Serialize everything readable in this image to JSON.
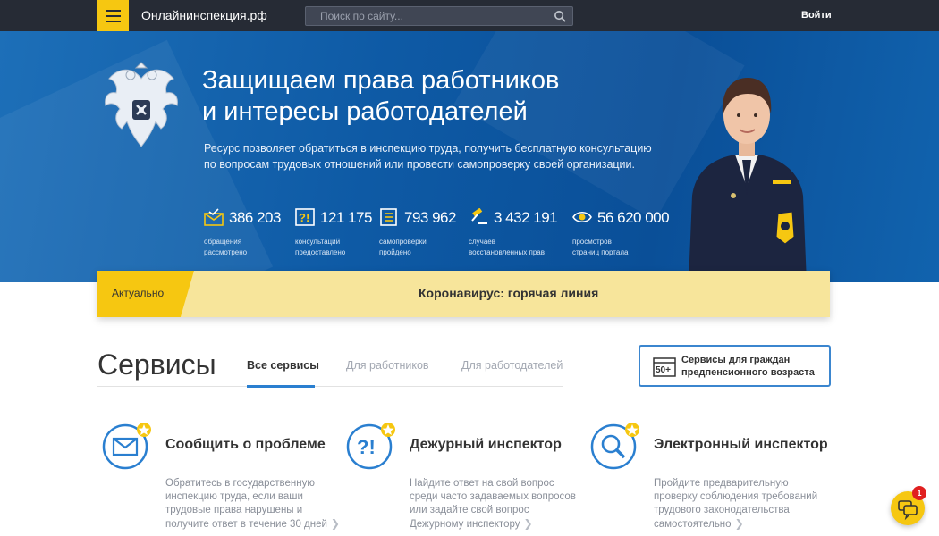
{
  "header": {
    "site_name": "Онлайнинспекция.рф",
    "search_placeholder": "Поиск по сайту...",
    "login_label": "Войти"
  },
  "hero": {
    "title_line1": "Защищаем права работников",
    "title_line2": "и интересы работодателей",
    "desc_line1": "Ресурс позволяет обратиться в инспекцию труда, получить бесплатную консультацию",
    "desc_line2": "по вопросам трудовых отношений или провести самопроверку своей организации.",
    "stats": [
      {
        "icon": "envelope-check-icon",
        "value": "386 203",
        "label1": "обращения",
        "label2": "рассмотрено"
      },
      {
        "icon": "question-icon",
        "value": "121 175",
        "label1": "консультаций",
        "label2": "предоставлено"
      },
      {
        "icon": "checklist-icon",
        "value": "793 962",
        "label1": "самопроверки",
        "label2": "пройдено"
      },
      {
        "icon": "gavel-icon",
        "value": "3 432 191",
        "label1": "случаев",
        "label2": "восстановленных прав"
      },
      {
        "icon": "eye-icon",
        "value": "56 620 000",
        "label1": "просмотров",
        "label2": "страниц портала"
      }
    ]
  },
  "actual": {
    "tag": "Актуально",
    "text": "Коронавирус: горячая линия"
  },
  "services": {
    "title": "Сервисы",
    "tabs": [
      {
        "label": "Все сервисы",
        "active": true
      },
      {
        "label": "Для работников",
        "active": false
      },
      {
        "label": "Для работодателей",
        "active": false
      }
    ],
    "pre_button": {
      "badge": "50+",
      "line1": "Сервисы для граждан",
      "line2": "предпенсионного возраста"
    },
    "cards": [
      {
        "icon": "envelope-icon",
        "title": "Сообщить о проблеме",
        "desc_lines": [
          "Обратитесь в государственную",
          "инспекцию труда, если ваши",
          "трудовые права нарушены и",
          "получите ответ в течение 30 дней"
        ]
      },
      {
        "icon": "question-icon",
        "title": "Дежурный инспектор",
        "desc_lines": [
          "Найдите ответ на свой вопрос",
          "среди часто задаваемых вопросов",
          "или задайте свой вопрос",
          "Дежурному инспектору"
        ]
      },
      {
        "icon": "magnifier-icon",
        "title": "Электронный инспектор",
        "desc_lines": [
          "Пройдите предварительную",
          "проверку соблюдения требований",
          "трудового законодательства",
          "самостоятельно"
        ]
      }
    ]
  },
  "chat": {
    "badge_count": "1"
  },
  "colors": {
    "accent_yellow": "#f6c711",
    "hero_blue": "#0e5aa5",
    "link_blue": "#2a7fd0",
    "topbar": "#262b35"
  }
}
